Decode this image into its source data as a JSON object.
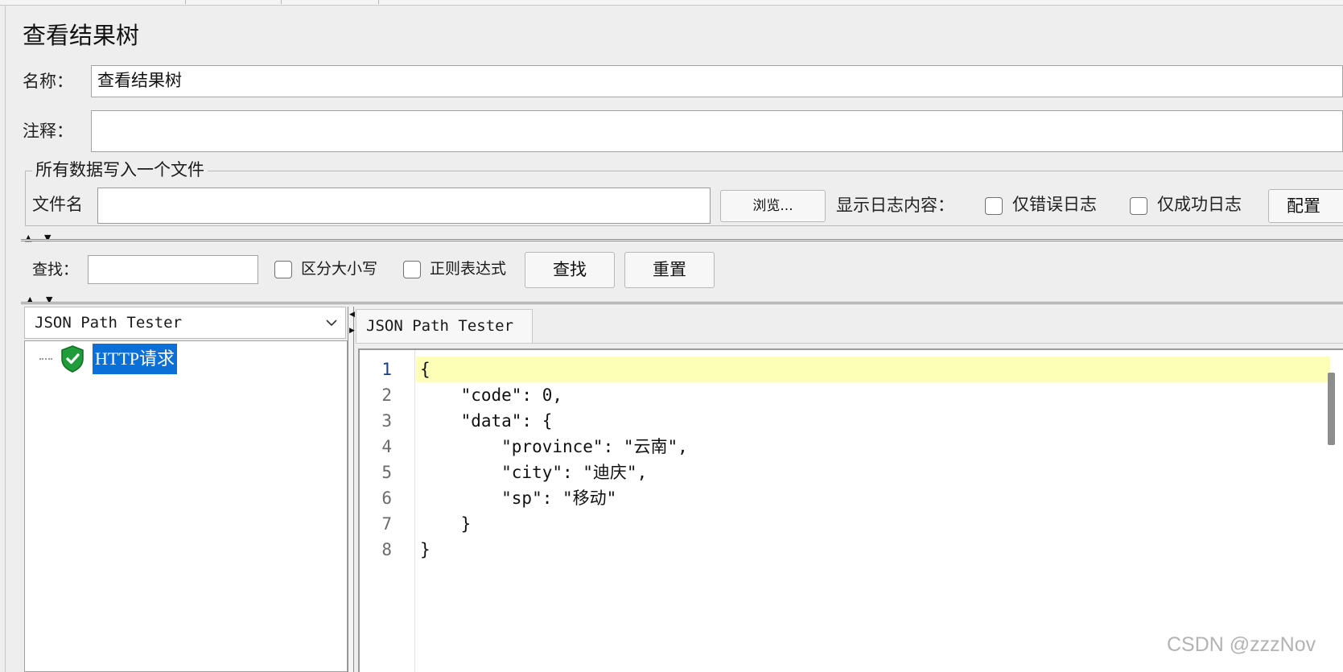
{
  "panel": {
    "title": "查看结果树",
    "name_label": "名称：",
    "name_value": "查看结果树",
    "comment_label": "注释：",
    "comment_value": ""
  },
  "file_group": {
    "title": "所有数据写入一个文件",
    "filename_label": "文件名",
    "filename_value": "",
    "browse_button": "浏览...",
    "log_content_label": "显示日志内容：",
    "errors_only_label": "仅错误日志",
    "success_only_label": "仅成功日志",
    "configure_button": "配置"
  },
  "search": {
    "label": "查找：",
    "value": "",
    "case_sensitive_label": "区分大小写",
    "regex_label": "正则表达式",
    "find_button": "查找",
    "reset_button": "重置"
  },
  "tree": {
    "renderer": "JSON Path Tester",
    "nodes": [
      {
        "label": "HTTP请求",
        "status": "success",
        "selected": true
      }
    ]
  },
  "viewer": {
    "tab": "JSON Path Tester",
    "current_line": 1,
    "lines": [
      {
        "n": "1",
        "text": "{"
      },
      {
        "n": "2",
        "text": "    \"code\": 0,"
      },
      {
        "n": "3",
        "text": "    \"data\": {"
      },
      {
        "n": "4",
        "text": "        \"province\": \"云南\","
      },
      {
        "n": "5",
        "text": "        \"city\": \"迪庆\","
      },
      {
        "n": "6",
        "text": "        \"sp\": \"移动\""
      },
      {
        "n": "7",
        "text": "    }"
      },
      {
        "n": "8",
        "text": "}"
      }
    ]
  },
  "watermark": "CSDN @zzzNov",
  "colors": {
    "selection": "#0a6fd6",
    "current_line": "#fcffb5",
    "success_icon": "#1f9d3a"
  },
  "icons": {
    "tree_node": "shield-check-icon",
    "dropdown": "chevron-down-icon"
  }
}
